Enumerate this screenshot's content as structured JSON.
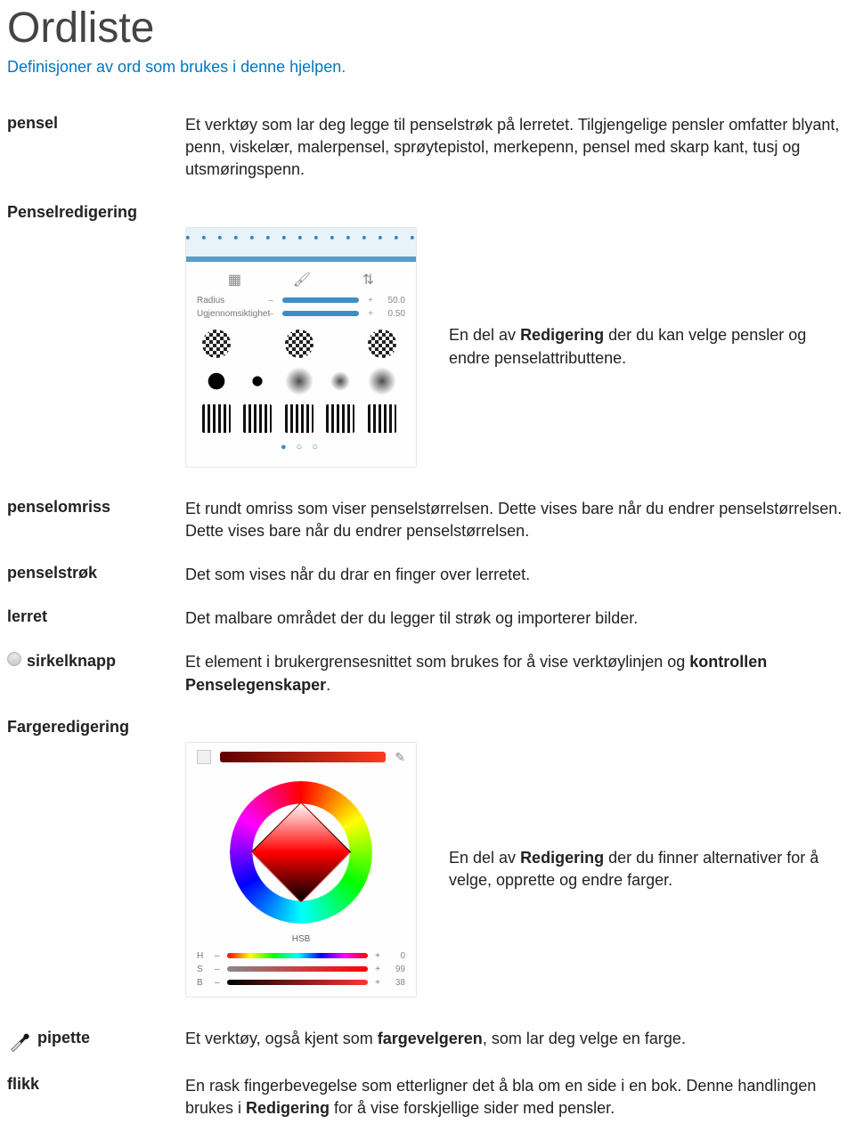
{
  "title": "Ordliste",
  "subtitle": "Definisjoner av ord som brukes i denne hjelpen.",
  "terms": {
    "pensel": {
      "label": "pensel",
      "def": "Et verktøy som lar deg legge til penselstrøk på lerretet. Tilgjengelige pensler omfatter blyant, penn, viskelær, malerpensel, sprøytepistol, merkepenn, pensel med skarp kant, tusj og utsmøringspenn."
    },
    "penselredigering": {
      "label": "Penselredigering",
      "caption_pre": "En del av ",
      "caption_bold": "Redigering",
      "caption_post": " der du kan velge pensler og endre penselattributtene."
    },
    "penselomriss": {
      "label": "penselomriss",
      "def": "Et rundt omriss som viser penselstørrelsen. Dette vises bare når du endrer penselstørrelsen. Dette vises bare når du endrer penselstørrelsen."
    },
    "penselstrok": {
      "label": "penselstrøk",
      "def": "Det som vises når du drar en finger over lerretet."
    },
    "lerret": {
      "label": "lerret",
      "def": "Det malbare området der du legger til strøk og importerer bilder."
    },
    "sirkelknapp": {
      "label": "sirkelknapp",
      "def_pre": "Et element i brukergrensesnittet som brukes for å vise verktøylinjen og ",
      "def_bold": "kontrollen Penselegenskaper",
      "def_post": "."
    },
    "fargeredigering": {
      "label": "Fargeredigering",
      "caption_pre": "En del av ",
      "caption_bold": "Redigering",
      "caption_post": " der du finner alternativer for å velge, opprette og endre farger."
    },
    "pipette": {
      "label": "pipette",
      "def_pre": "Et verktøy, også kjent som ",
      "def_bold": "fargevelgeren",
      "def_post": ", som lar deg velge en farge."
    },
    "flikk": {
      "label": "flikk",
      "def_pre": "En rask fingerbevegelse som etterligner det å bla om en side i en bok. Denne handlingen brukes i ",
      "def_bold": "Redigering",
      "def_post": " for å vise forskjellige sider med pensler."
    }
  },
  "brush_panel": {
    "slider1_label": "Radius",
    "slider1_value": "50.0",
    "slider2_label": "Ugjennomsiktighet",
    "slider2_value": "0.50"
  },
  "color_panel": {
    "tab_label": "HSB",
    "h_label": "H",
    "h_val": "0",
    "s_label": "S",
    "s_val": "99",
    "b_label": "B",
    "b_val": "38",
    "minus": "–",
    "plus": "+"
  }
}
